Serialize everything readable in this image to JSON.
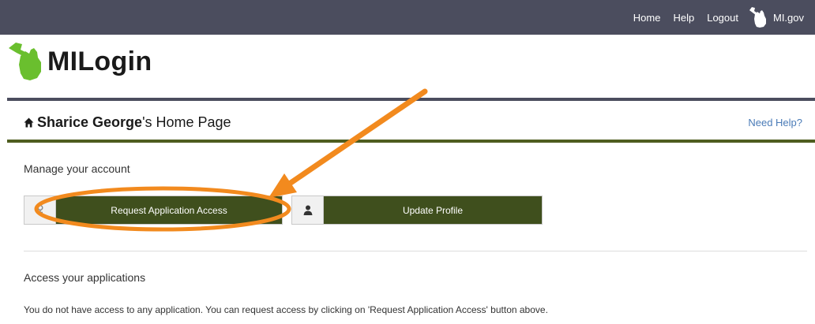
{
  "topnav": {
    "home": "Home",
    "help": "Help",
    "logout": "Logout",
    "mi_gov": "MI.gov"
  },
  "brand": {
    "name": "MILogin",
    "accent_color": "#6abf2e"
  },
  "header": {
    "user_name": "Sharice George",
    "title_suffix": "'s Home Page",
    "need_help": "Need Help?"
  },
  "manage": {
    "heading": "Manage your account",
    "request_access_label": "Request Application Access",
    "update_profile_label": "Update Profile",
    "button_color": "#3f4f1d"
  },
  "applications": {
    "heading": "Access your applications",
    "message": "You do not have access to any application. You can request access by clicking on 'Request Application Access' button above."
  },
  "annotation": {
    "color": "#f28a1e",
    "target": "Request Application Access"
  },
  "icons": {
    "home": "home-icon",
    "request": "key-icon",
    "profile": "person-icon",
    "logo": "michigan-mitten-logo"
  }
}
